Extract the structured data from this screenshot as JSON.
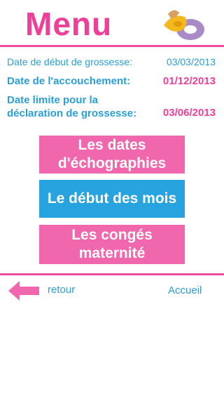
{
  "header": {
    "title": "Menu",
    "logo_icon": "pacifier-icon"
  },
  "dates": [
    {
      "label": "Date de début de grossesse:",
      "value": "03/03/2013"
    },
    {
      "label": "Date de l'accouchement:",
      "value": "01/12/2013"
    },
    {
      "label_line1": "Date limite pour la",
      "label_line2": "déclaration de grossesse:",
      "value": "03/06/2013"
    }
  ],
  "buttons": {
    "echographies": "Les dates d'échographies",
    "debut_mois": "Le début des mois",
    "conges": "Les congés maternité"
  },
  "nav": {
    "back_label": "retour",
    "home_label": "Accueil",
    "back_icon": "left-arrow-icon"
  },
  "colors": {
    "pink": "#ee3f99",
    "pink_button": "#f067ad",
    "blue": "#2a9fd8",
    "blue_button": "#27a4e0"
  }
}
